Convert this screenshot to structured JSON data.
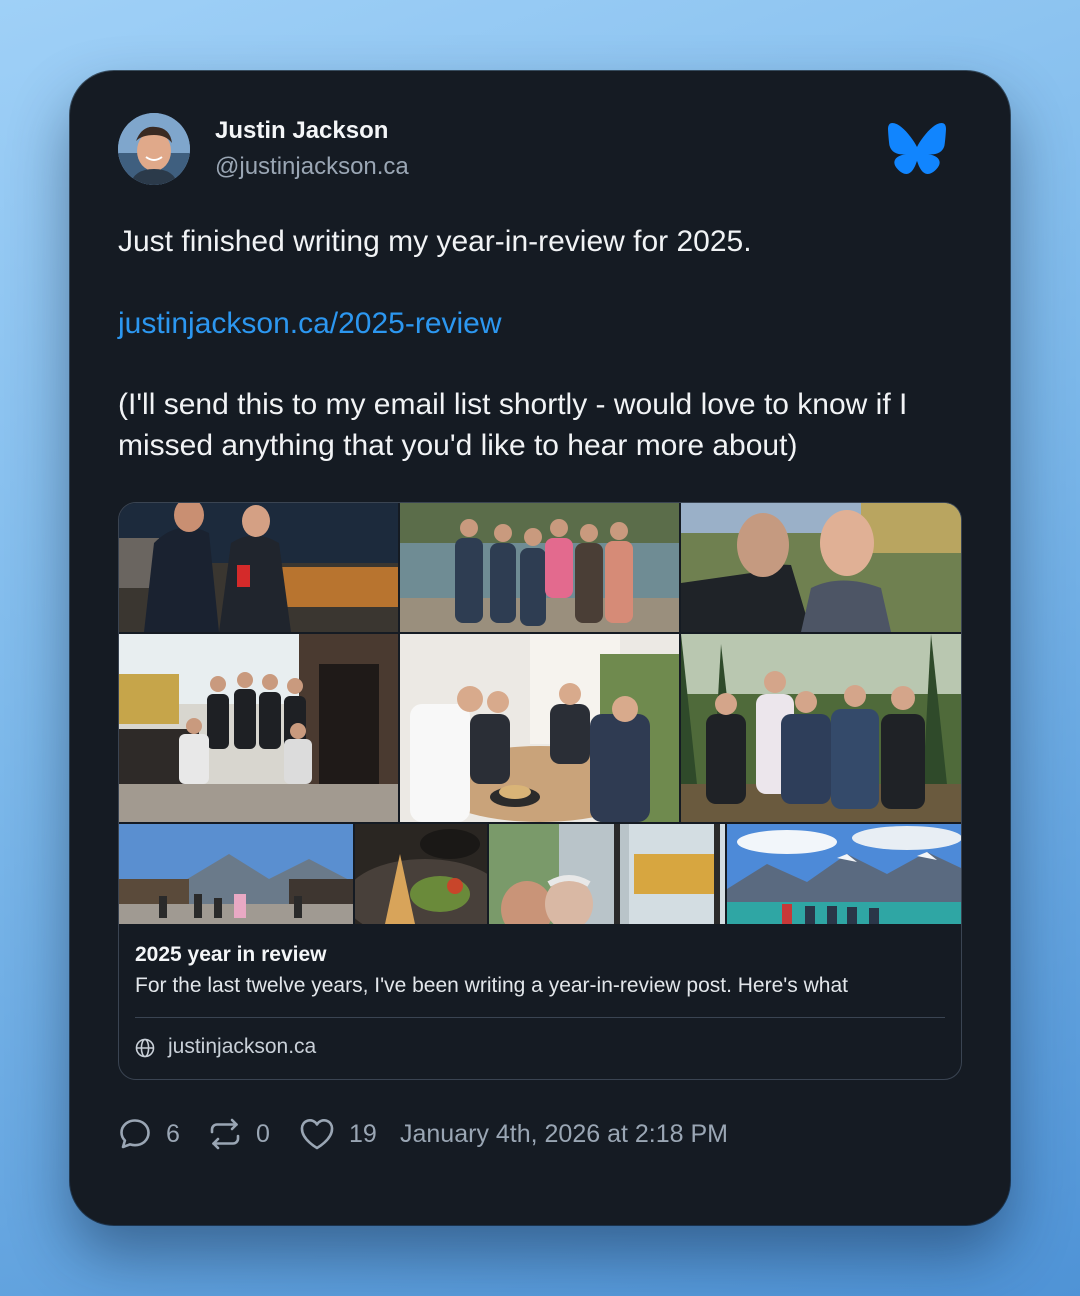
{
  "author": {
    "name": "Justin Jackson",
    "handle": "@justinjackson.ca"
  },
  "post": {
    "line1": "Just finished writing my year-in-review for 2025.",
    "link": "justinjackson.ca/2025-review",
    "line3": "(I'll send this to my email list shortly - would love to know if I missed anything that you'd like to hear more about)"
  },
  "embed": {
    "title": "2025 year in review",
    "description": "For the last twelve years, I've been writing a year-in-review post. Here's what",
    "domain": "justinjackson.ca",
    "domain_icon": "globe-icon"
  },
  "actions": {
    "replies": "6",
    "reposts": "0",
    "likes": "19",
    "timestamp": "January 4th, 2026 at 2:18 PM"
  },
  "colors": {
    "card_bg": "#151b23",
    "link": "#2c97f0",
    "bluesky_brand": "#1185fe",
    "muted_text": "#9aa6b4"
  },
  "icons": [
    "bluesky-butterfly-icon",
    "reply-icon",
    "repost-icon",
    "like-heart-icon",
    "globe-icon"
  ]
}
